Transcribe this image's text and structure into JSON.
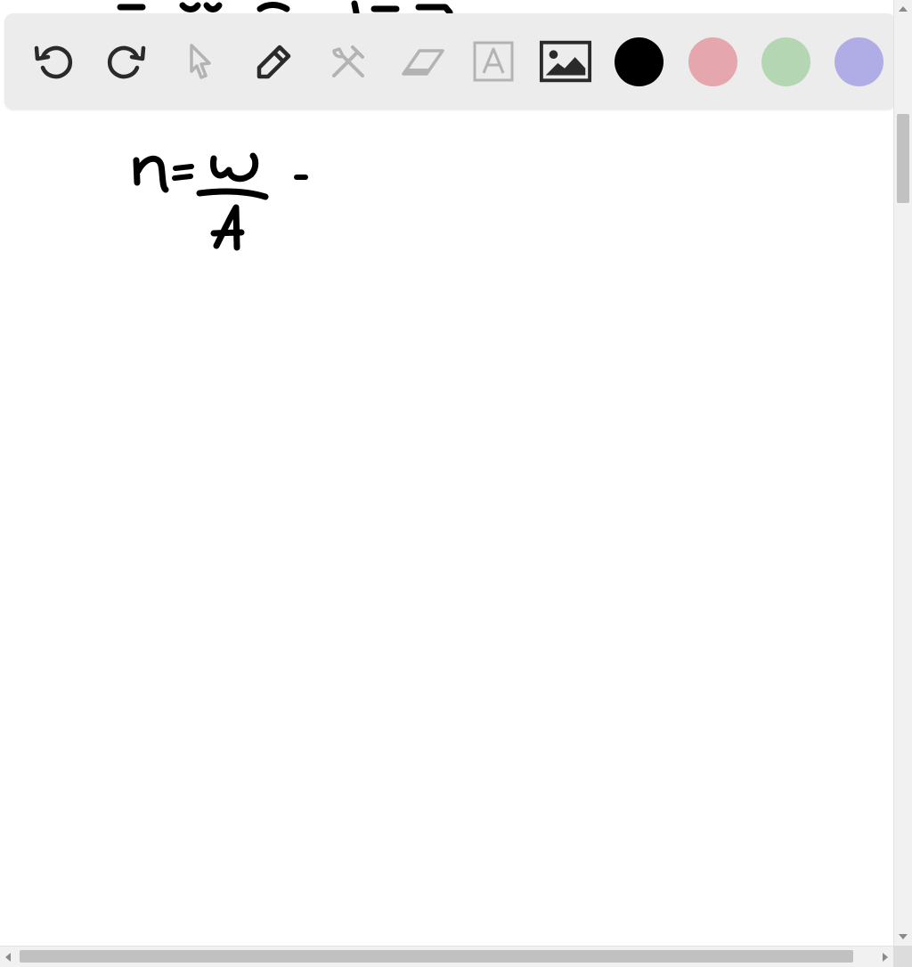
{
  "toolbar": {
    "tools": [
      {
        "name": "undo-icon",
        "enabled": true
      },
      {
        "name": "redo-icon",
        "enabled": true
      },
      {
        "name": "select-pointer-icon",
        "enabled": false
      },
      {
        "name": "pen-icon",
        "enabled": true
      },
      {
        "name": "tools-icon",
        "enabled": false
      },
      {
        "name": "eraser-icon",
        "enabled": false
      },
      {
        "name": "text-icon",
        "enabled": false
      },
      {
        "name": "image-icon",
        "enabled": true
      }
    ],
    "colors": {
      "black": "#000000",
      "pink": "#e6a6ad",
      "green": "#b5d6b2",
      "purple": "#b0ade6"
    },
    "icon_color_enabled": "#2a2a2a",
    "icon_color_disabled": "#b3b3b3"
  },
  "canvas": {
    "ink_color": "#000000",
    "handwritten_formula": "η = W / A ·"
  }
}
